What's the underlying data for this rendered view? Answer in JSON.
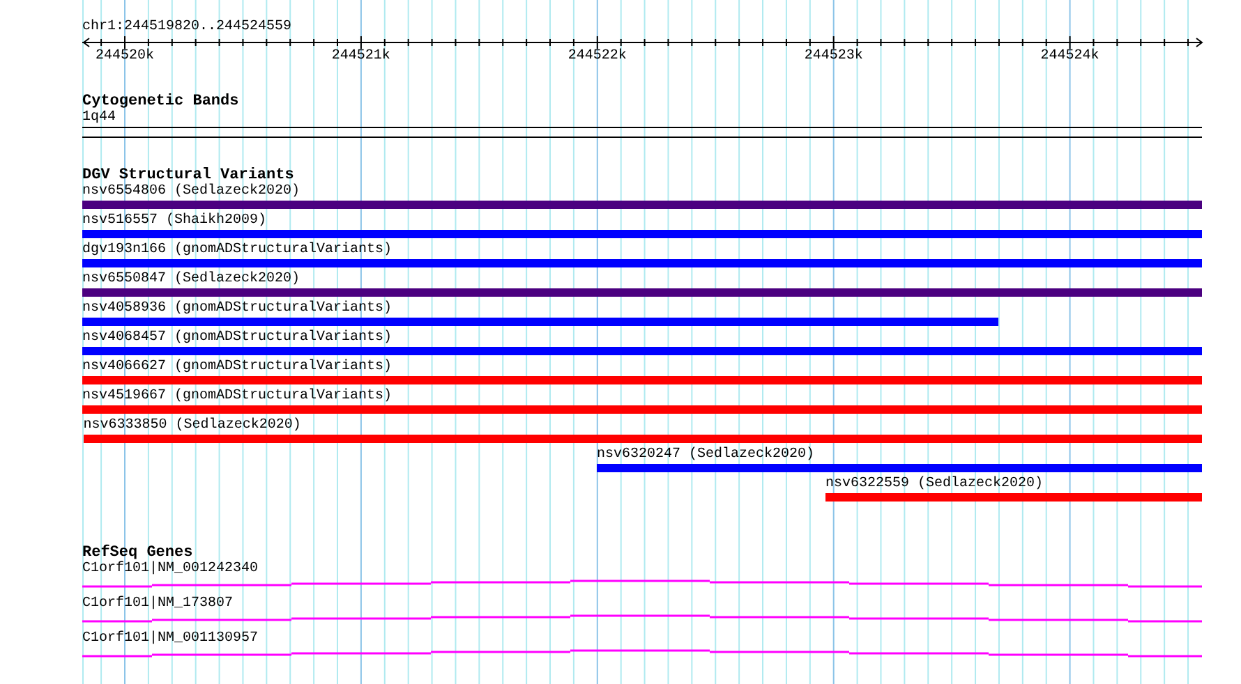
{
  "ruler": {
    "location": "chr1:244519820..244524559",
    "tick_labels": [
      "244520k",
      "244521k",
      "244522k",
      "244523k",
      "244524k"
    ]
  },
  "tracks": [
    {
      "kind": "cytoband",
      "title": "Cytogenetic Bands",
      "features": [
        {
          "label": "1q44"
        }
      ]
    },
    {
      "kind": "variants",
      "title": "DGV Structural Variants",
      "features": [
        {
          "label": "nsv6554806 (Sedlazeck2020)",
          "color": "#4b0080"
        },
        {
          "label": "nsv516557 (Shaikh2009)",
          "color": "#0000ff"
        },
        {
          "label": "dgv193n166 (gnomADStructuralVariants)",
          "color": "#0000ff"
        },
        {
          "label": "nsv6550847 (Sedlazeck2020)",
          "color": "#4b0080"
        },
        {
          "label": "nsv4058936 (gnomADStructuralVariants)",
          "color": "#0000ff"
        },
        {
          "label": "nsv4068457 (gnomADStructuralVariants)",
          "color": "#0000ff"
        },
        {
          "label": "nsv4066627 (gnomADStructuralVariants)",
          "color": "#ff0000"
        },
        {
          "label": "nsv4519667 (gnomADStructuralVariants)",
          "color": "#ff0000"
        },
        {
          "label": "nsv6333850 (Sedlazeck2020)",
          "color": "#ff0000"
        },
        {
          "label": "nsv6320247 (Sedlazeck2020)",
          "color": "#0000ff"
        },
        {
          "label": "nsv6322559 (Sedlazeck2020)",
          "color": "#ff0000"
        }
      ]
    },
    {
      "kind": "genes",
      "title": "RefSeq Genes",
      "features": [
        {
          "label": "C1orf101|NM_001242340"
        },
        {
          "label": "C1orf101|NM_173807"
        },
        {
          "label": "C1orf101|NM_001130957"
        }
      ]
    }
  ]
}
